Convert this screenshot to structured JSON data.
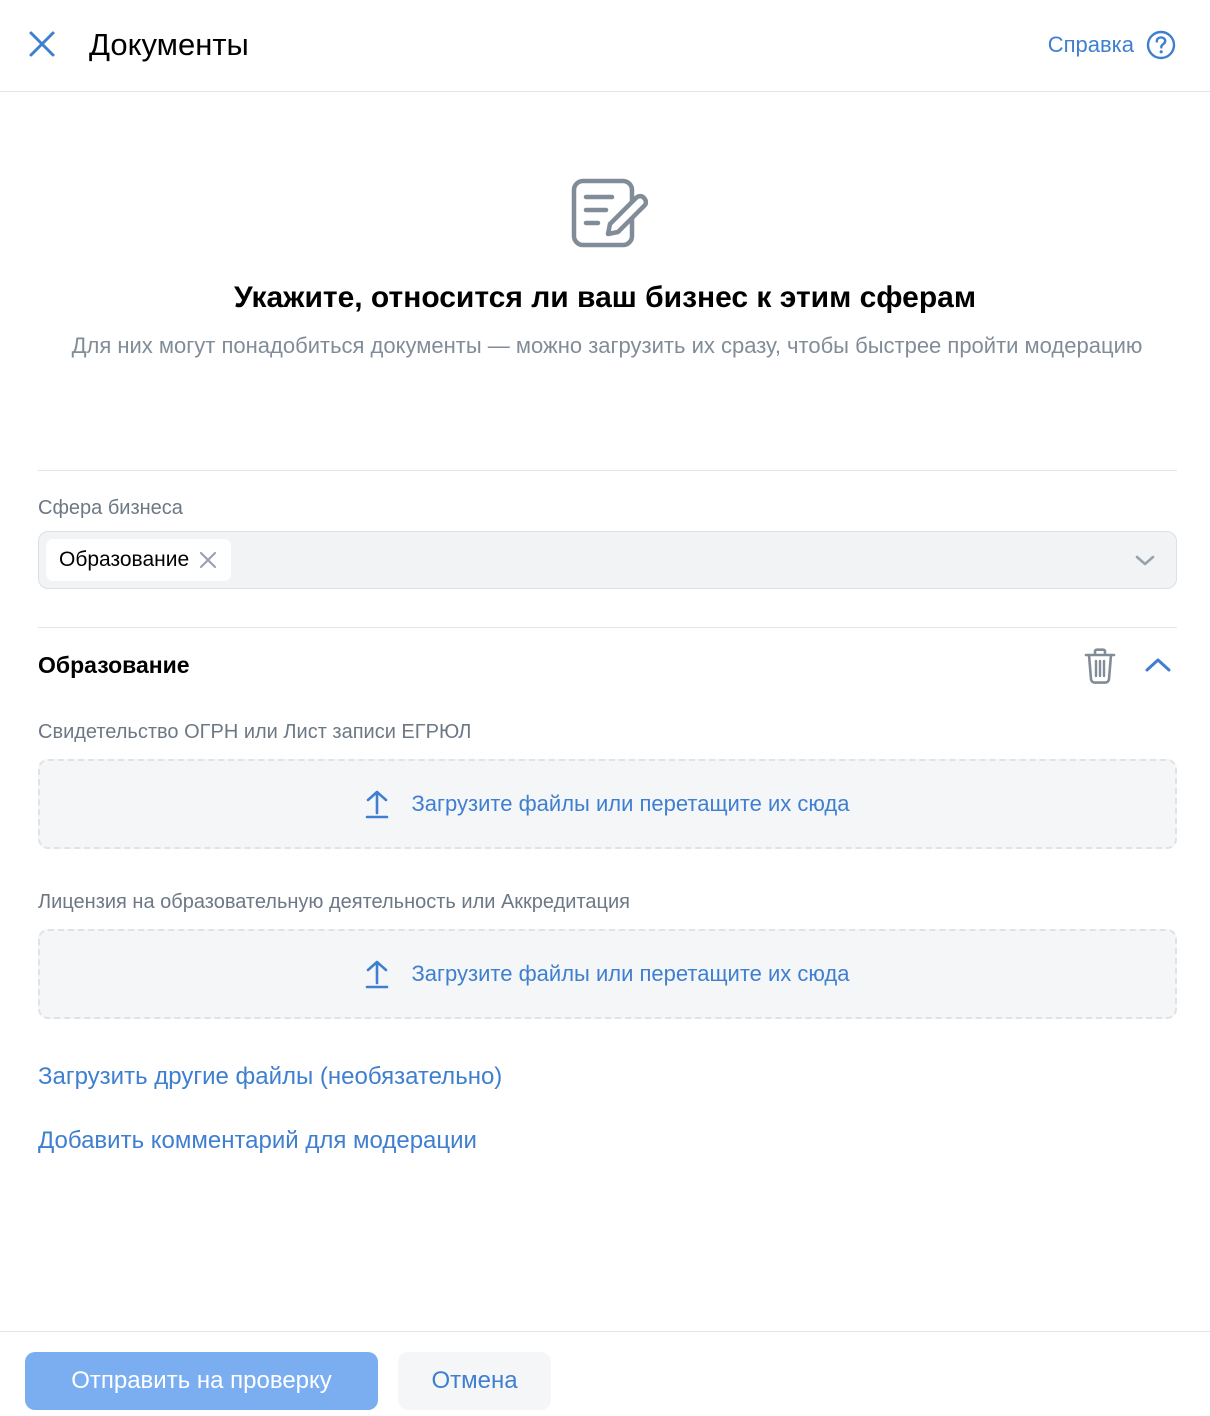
{
  "header": {
    "title": "Документы",
    "help_label": "Справка",
    "close_icon": "close-icon",
    "help_icon": "question-circle-icon"
  },
  "intro": {
    "icon": "document-edit-icon",
    "title": "Укажите, относится ли ваш бизнес к этим сферам",
    "subtitle": "Для них могут понадобиться документы — можно загрузить их сразу,  чтобы быстрее пройти модерацию"
  },
  "business_field": {
    "label": "Сфера бизнеса",
    "selected": [
      {
        "label": "Образование"
      }
    ]
  },
  "section": {
    "title": "Образование",
    "documents": [
      {
        "label": "Свидетельство ОГРН или Лист записи ЕГРЮЛ",
        "upload_text": "Загрузите файлы или перетащите их сюда"
      },
      {
        "label": "Лицензия на образовательную деятельность или Аккредитация",
        "upload_text": "Загрузите файлы или перетащите их сюда"
      }
    ],
    "other_files_link": "Загрузить другие файлы (необязательно)",
    "comment_link": "Добавить комментарий для модерации"
  },
  "footer": {
    "submit_label": "Отправить на проверку",
    "cancel_label": "Отмена"
  },
  "colors": {
    "accent": "#3f7fd0",
    "primary_button": "#7aaef0",
    "secondary_text": "#818c99"
  }
}
